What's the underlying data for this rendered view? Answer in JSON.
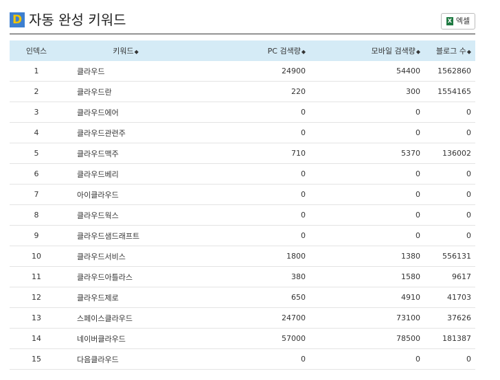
{
  "header": {
    "logo": "D",
    "title": "자동 완성 키워드",
    "excel_label": "엑셀"
  },
  "table": {
    "columns": [
      "인덱스",
      "키워드",
      "PC 검색량",
      "모바일 검색량",
      "블로그 수"
    ],
    "sort_symbol": "◆",
    "rows": [
      [
        "1",
        "클라우드",
        "24900",
        "54400",
        "1562860"
      ],
      [
        "2",
        "클라우드란",
        "220",
        "300",
        "1554165"
      ],
      [
        "3",
        "클라우드에어",
        "0",
        "0",
        "0"
      ],
      [
        "4",
        "클라우드관련주",
        "0",
        "0",
        "0"
      ],
      [
        "5",
        "클라우드맥주",
        "710",
        "5370",
        "136002"
      ],
      [
        "6",
        "클라우드베리",
        "0",
        "0",
        "0"
      ],
      [
        "7",
        "아이클라우드",
        "0",
        "0",
        "0"
      ],
      [
        "8",
        "클라우드웍스",
        "0",
        "0",
        "0"
      ],
      [
        "9",
        "클라우드샘드래프트",
        "0",
        "0",
        "0"
      ],
      [
        "10",
        "클라우드서비스",
        "1800",
        "1380",
        "556131"
      ],
      [
        "11",
        "클라우드아틀라스",
        "380",
        "1580",
        "9617"
      ],
      [
        "12",
        "클라우드제로",
        "650",
        "4910",
        "41703"
      ],
      [
        "13",
        "스페이스클라우드",
        "24700",
        "73100",
        "37626"
      ],
      [
        "14",
        "네이버클라우드",
        "57000",
        "78500",
        "181387"
      ],
      [
        "15",
        "다음클라우드",
        "0",
        "0",
        "0"
      ]
    ]
  }
}
